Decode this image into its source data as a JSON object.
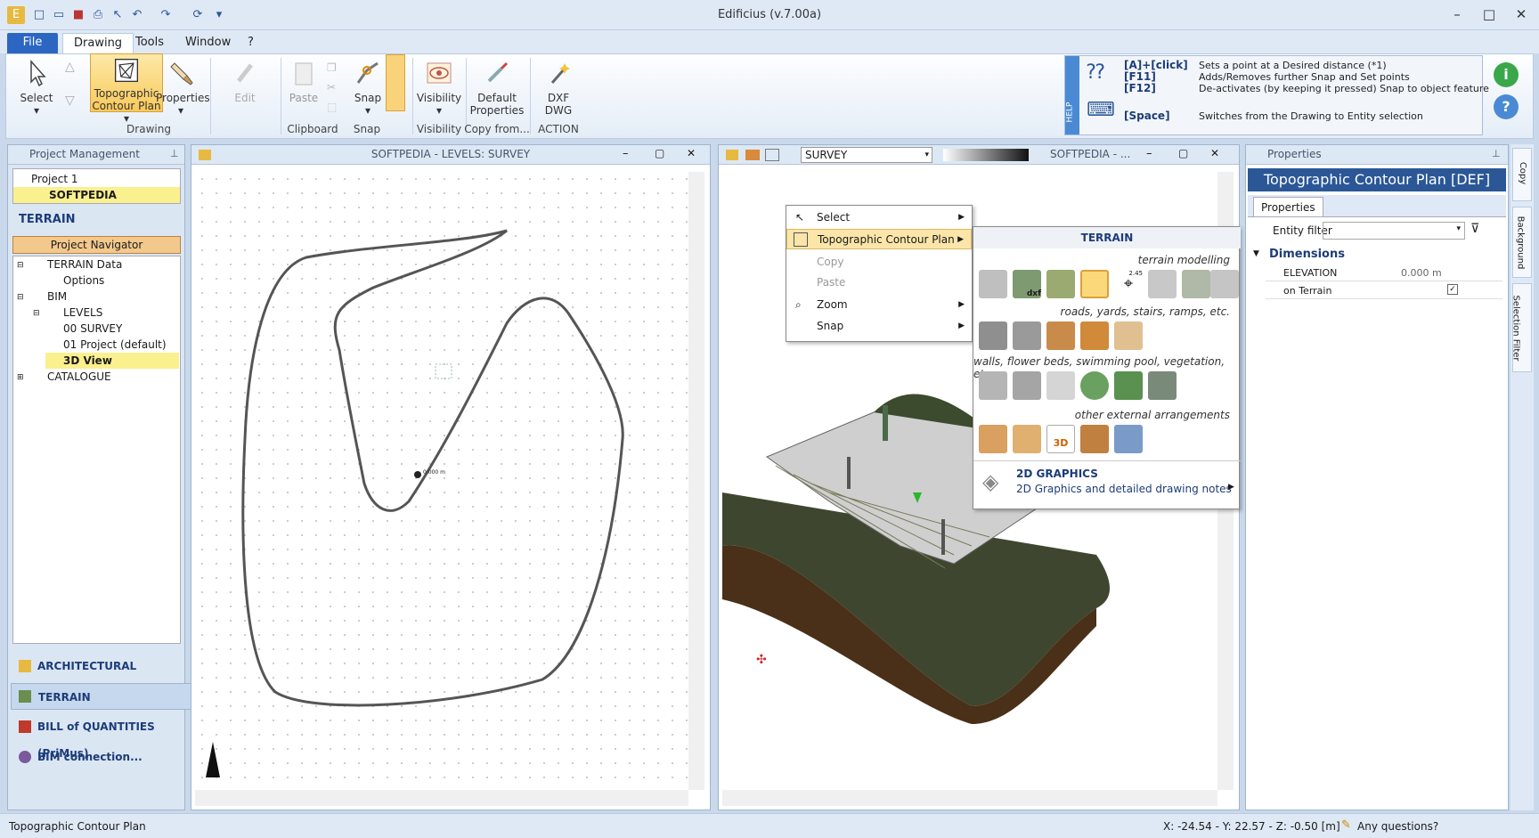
{
  "window": {
    "title": "Edificius (v.7.00a)"
  },
  "tabs": [
    "File",
    "Drawing",
    "Tools",
    "Window",
    "?"
  ],
  "ribbon": {
    "select": "Select",
    "topo": "Topographic Contour Plan",
    "properties": "Properties",
    "edit": "Edit",
    "paste": "Paste",
    "snap": "Snap",
    "visibility": "Visibility",
    "default_props": "Default Properties",
    "dxf": "DXF DWG",
    "groups": {
      "drawing": "Drawing",
      "clipboard": "Clipboard",
      "snap": "Snap",
      "visibility": "Visibility",
      "copy_from": "Copy from...",
      "action": "ACTION"
    }
  },
  "help": {
    "tab": "HELP",
    "rows": [
      {
        "key": "[A]+[click]",
        "desc": "Sets a point at a Desired distance (*1)"
      },
      {
        "key": "[F11]",
        "desc": "Adds/Removes further Snap and Set points"
      },
      {
        "key": "[F12]",
        "desc": "De-activates (by keeping it pressed) Snap to object feature"
      },
      {
        "key": "[Space]",
        "desc": "Switches from the Drawing to Entity selection"
      }
    ]
  },
  "project": {
    "header": "Project Management",
    "items": [
      "Project 1",
      "SOFTPEDIA"
    ],
    "section": "TERRAIN",
    "navigator": "Project Navigator",
    "tree": [
      "TERRAIN Data",
      "Options",
      "BIM",
      "LEVELS",
      "00 SURVEY",
      "01 Project (default)",
      "3D View",
      "CATALOGUE"
    ],
    "bottom": [
      "ARCHITECTURAL",
      "TERRAIN",
      "BILL of QUANTITIES (PriMus)",
      "BIM connection..."
    ]
  },
  "view2d": {
    "title": "SOFTPEDIA -  LEVELS: SURVEY",
    "label": "0.000 m"
  },
  "view3d": {
    "level": "SURVEY",
    "title": "SOFTPEDIA - ..."
  },
  "context": {
    "items": [
      "Select",
      "Topographic Contour Plan",
      "Copy",
      "Paste",
      "Zoom",
      "Snap"
    ]
  },
  "submenu": {
    "header": "TERRAIN",
    "sections": [
      "terrain modelling",
      "roads, yards, stairs, ramps, etc.",
      "walls, flower beds, swimming pool, vegetation, etc.",
      "other external arrangements"
    ],
    "graphics_title": "2D GRAPHICS",
    "graphics_desc": "2D Graphics and detailed drawing notes",
    "dxf": "dxf",
    "tag245": "2.45",
    "tag3d": "3D"
  },
  "properties": {
    "header": "Properties",
    "title": "Topographic Contour Plan [DEF]",
    "tab": "Properties",
    "filter_label": "Entity filter",
    "group": "Dimensions",
    "rows": [
      {
        "name": "ELEVATION",
        "value": "0.000 m"
      },
      {
        "name": "on Terrain",
        "value": "✓"
      }
    ]
  },
  "side_tabs": [
    "Copy",
    "Background",
    "Selection Filter"
  ],
  "status": {
    "left": "Topographic Contour Plan",
    "coords": "X: -24.54 - Y: 22.57 - Z: -0.50 [m]",
    "help": "Any questions?"
  }
}
